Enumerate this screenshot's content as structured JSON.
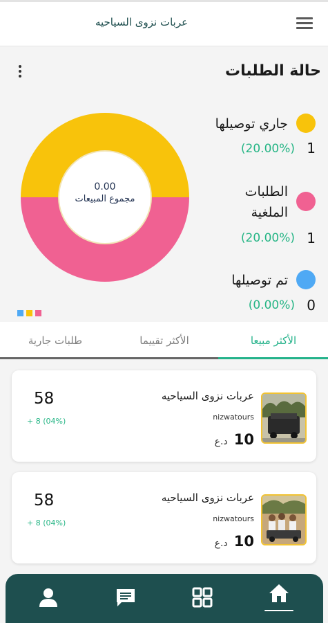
{
  "app": {
    "title": "عربات نزوى السياحيه"
  },
  "icons": {
    "menu": "hamburger-menu-icon",
    "more": "more-vertical-icon"
  },
  "orders_status": {
    "title": "حالة الطلبات",
    "total_value": "0.00",
    "total_label": "مجموع المبيعات",
    "legend": [
      {
        "label": "جاري توصيلها",
        "count": "1",
        "percent": "(20.00%)",
        "color": "#f8c30b"
      },
      {
        "label_line1": "الطلبات",
        "label_line2": "الملغية",
        "count": "1",
        "percent": "(20.00%)",
        "color": "#f06192"
      },
      {
        "label": "تم توصيلها",
        "count": "0",
        "percent": "(0.00%)",
        "color": "#4fa9f4"
      }
    ]
  },
  "chart_data": {
    "type": "pie",
    "title": "",
    "center_value": "0.00",
    "center_label": "مجموع المبيعات",
    "categories": [
      "جاري توصيلها",
      "الطلبات الملغية",
      "تم توصيلها"
    ],
    "values": [
      1,
      1,
      0
    ],
    "percents": [
      20.0,
      20.0,
      0.0
    ],
    "colors": [
      "#f8c30b",
      "#f06192",
      "#4fa9f4"
    ]
  },
  "tabs": [
    {
      "label": "الأكثر مبيعا",
      "active": true
    },
    {
      "label": "الأكثر تقييما",
      "active": false
    },
    {
      "label": "طلبات جارية",
      "active": false
    }
  ],
  "products": [
    {
      "name": "عربات نزوى السياحيه",
      "username": "nizwatours",
      "price": "10",
      "currency": "د.ع",
      "stat": "58",
      "change": "+ 8 (04%)"
    },
    {
      "name": "عربات نزوى السياحيه",
      "username": "nizwatours",
      "price": "10",
      "currency": "د.ع",
      "stat": "58",
      "change": "+ 8 (04%)"
    }
  ],
  "bottom_nav": [
    {
      "icon": "home-icon",
      "active": true
    },
    {
      "icon": "grid-icon",
      "active": false
    },
    {
      "icon": "chat-icon",
      "active": false
    },
    {
      "icon": "profile-icon",
      "active": false
    }
  ],
  "colors": {
    "primary": "#1e4f4f",
    "accent": "#24b28a"
  }
}
